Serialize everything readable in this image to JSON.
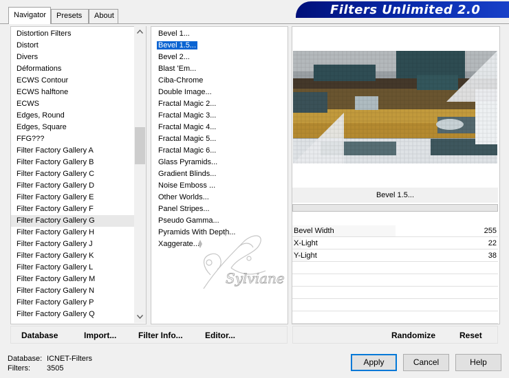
{
  "tabs": [
    "Navigator",
    "Presets",
    "About"
  ],
  "title": "Filters Unlimited 2.0",
  "categories": [
    "Distortion Filters",
    "Distort",
    "Divers",
    "Déformations",
    "ECWS Contour",
    "ECWS halftone",
    "ECWS",
    "Edges, Round",
    "Edges, Square",
    "FFG???",
    "Filter Factory Gallery A",
    "Filter Factory Gallery B",
    "Filter Factory Gallery C",
    "Filter Factory Gallery D",
    "Filter Factory Gallery E",
    "Filter Factory Gallery F",
    "Filter Factory Gallery G",
    "Filter Factory Gallery H",
    "Filter Factory Gallery J",
    "Filter Factory Gallery K",
    "Filter Factory Gallery L",
    "Filter Factory Gallery M",
    "Filter Factory Gallery N",
    "Filter Factory Gallery P",
    "Filter Factory Gallery Q"
  ],
  "hovered_category": "Filter Factory Gallery G",
  "filters": [
    "Bevel 1...",
    "Bevel 1.5...",
    "Bevel 2...",
    "Blast 'Em...",
    "Ciba-Chrome",
    "Double Image...",
    "Fractal Magic 2...",
    "Fractal Magic 3...",
    "Fractal Magic 4...",
    "Fractal Magic 5...",
    "Fractal Magic 6...",
    "Glass Pyramids...",
    "Gradient Blinds...",
    "Noise Emboss ...",
    "Other Worlds...",
    "Panel Stripes...",
    "Pseudo Gamma...",
    "Pyramids With Depth...",
    "Xaggerate..."
  ],
  "selected_filter": "Bevel 1.5...",
  "filter_name": "Bevel 1.5...",
  "params": [
    {
      "label": "Bevel Width",
      "value": "255",
      "level": 1.0
    },
    {
      "label": "X-Light",
      "value": "22",
      "level": 0.086
    },
    {
      "label": "Y-Light",
      "value": "38",
      "level": 0.149
    }
  ],
  "buttons": {
    "database": "Database",
    "import": "Import...",
    "filter_info": "Filter Info...",
    "editor": "Editor...",
    "randomize": "Randomize",
    "reset": "Reset",
    "apply": "Apply",
    "cancel": "Cancel",
    "help": "Help"
  },
  "status": {
    "database_label": "Database:",
    "database_value": "ICNET-Filters",
    "filters_label": "Filters:",
    "filters_value": "3505"
  },
  "icons": {
    "scroll_up": "chevron-up-icon",
    "scroll_down": "chevron-down-icon"
  }
}
